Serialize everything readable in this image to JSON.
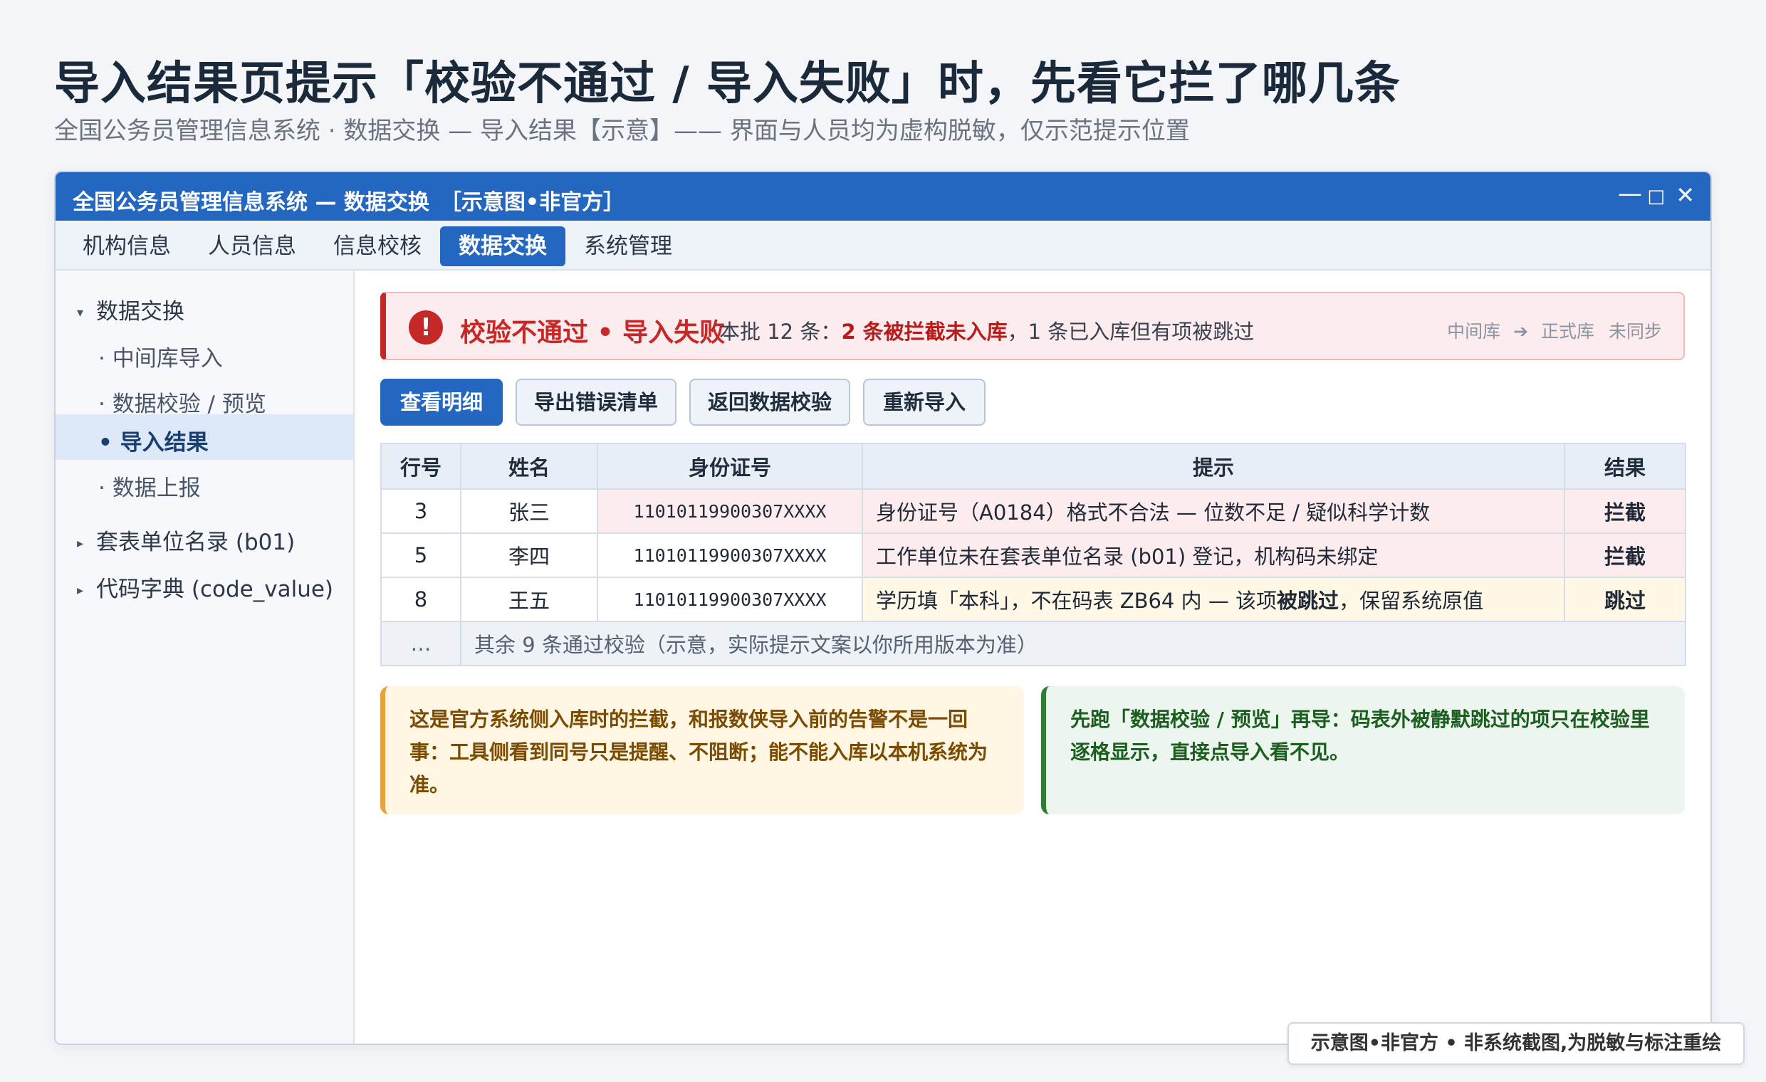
{
  "header": {
    "title": "导入结果页提示「校验不通过 / 导入失败」时，先看它拦了哪几条",
    "subtitle": "全国公务员管理信息系统 · 数据交换 — 导入结果【示意】—— 界面与人员均为虚构脱敏，仅示范提示位置"
  },
  "window": {
    "title": "全国公务员管理信息系统 — 数据交换　［示意图•非官方］",
    "controls": {
      "minimize": "—",
      "maximize": "□",
      "close": "✕"
    }
  },
  "menubar": {
    "items": [
      {
        "label": "机构信息"
      },
      {
        "label": "人员信息"
      },
      {
        "label": "信息校核"
      },
      {
        "label": "数据交换"
      },
      {
        "label": "系统管理"
      }
    ],
    "active_index": 3
  },
  "sidebar": {
    "items": [
      {
        "label": "数据交换"
      },
      {
        "label": "· 中间库导入"
      },
      {
        "label": "· 数据校验 / 预览"
      },
      {
        "label": "• 导入结果"
      },
      {
        "label": "· 数据上报"
      },
      {
        "label": "套表单位名录 (b01)"
      },
      {
        "label": "代码字典 (code_value)"
      }
    ],
    "icons": {
      "expanded": "▾",
      "collapsed": "▸"
    }
  },
  "alert": {
    "icon": "!",
    "title": "校验不通过 • 导入失败",
    "detail_prefix": "本批 12 条：",
    "detail_bold": "2 条被拦截未入库",
    "detail_suffix": "，1 条已入库但有项被跳过",
    "flow": {
      "from": "中间库",
      "arrow": "➔",
      "to": "正式库",
      "status": "未同步"
    },
    "accent_color": "#c62828"
  },
  "actions": [
    {
      "label": "查看明细"
    },
    {
      "label": "导出错误清单"
    },
    {
      "label": "返回数据校验"
    },
    {
      "label": "重新导入"
    }
  ],
  "table": {
    "columns": [
      "行号",
      "姓名",
      "身份证号",
      "提示",
      "结果"
    ],
    "rows": [
      {
        "row": "3",
        "name": "张三",
        "id": "11010119900307XXXX",
        "hint": "身份证号（A0184）格式不合法 — 位数不足 / 疑似科学计数",
        "result": "拦截",
        "status": "blocked"
      },
      {
        "row": "5",
        "name": "李四",
        "id": "11010119900307XXXX",
        "hint": "工作单位未在套表单位名录 (b01) 登记，机构码未绑定",
        "result": "拦截",
        "status": "blocked"
      },
      {
        "row": "8",
        "name": "王五",
        "id": "11010119900307XXXX",
        "hint_pre": "学历填「本科」，不在码表 ZB64 内 — 该项",
        "hint_bold": "被跳过",
        "hint_post": "，保留系统原值",
        "result": "跳过",
        "status": "skipped"
      }
    ],
    "rest_row": {
      "row": "…",
      "text": "其余 9 条通过校验（示意，实际提示文案以你所用版本为准）"
    }
  },
  "notes": [
    {
      "text": "这是官方系统侧入库时的拦截，和报数侠导入前的告警不是一回事：工具侧看到同号只是提醒、不阻断；能不能入库以本机系统为准。",
      "color": "#e8a23a"
    },
    {
      "text": "先跑「数据校验 / 预览」再导：码表外被静默跳过的项只在校验里逐格显示，直接点导入看不见。",
      "color": "#2e7d32"
    }
  ],
  "footer_stamp": "示意图•非官方 • 非系统截图,为脱敏与标注重绘"
}
